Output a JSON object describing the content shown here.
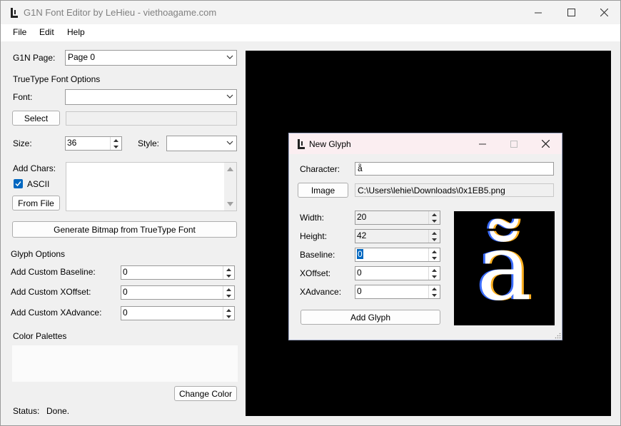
{
  "window": {
    "title": "G1N Font Editor by LeHieu - viethoagame.com"
  },
  "menu": {
    "file": "File",
    "edit": "Edit",
    "help": "Help"
  },
  "left": {
    "g1n_page_label": "G1N Page:",
    "g1n_page_value": "Page 0",
    "ttf_section": "TrueType Font Options",
    "font_label": "Font:",
    "font_value": "",
    "select_button": "Select",
    "size_label": "Size:",
    "size_value": "36",
    "style_label": "Style:",
    "style_value": "",
    "add_chars_label": "Add Chars:",
    "ascii_label": "ASCII",
    "ascii_checked": true,
    "from_file_button": "From File",
    "generate_button": "Generate Bitmap from TrueType Font",
    "glyph_section": "Glyph Options",
    "custom_baseline_label": "Add Custom Baseline:",
    "custom_baseline_value": "0",
    "custom_xoffset_label": "Add Custom XOffset:",
    "custom_xoffset_value": "0",
    "custom_xadvance_label": "Add Custom XAdvance:",
    "custom_xadvance_value": "0",
    "color_palettes_label": "Color Palettes",
    "change_color_button": "Change Color",
    "status_label": "Status:",
    "status_value": "Done."
  },
  "dialog": {
    "title": "New Glyph",
    "character_label": "Character:",
    "character_value": "ẵ",
    "image_button": "Image",
    "image_path": "C:\\Users\\lehie\\Downloads\\0x1EB5.png",
    "width_label": "Width:",
    "width_value": "20",
    "height_label": "Height:",
    "height_value": "42",
    "baseline_label": "Baseline:",
    "baseline_value": "0",
    "xoffset_label": "XOffset:",
    "xoffset_value": "0",
    "xadvance_label": "XAdvance:",
    "xadvance_value": "0",
    "add_glyph_button": "Add Glyph",
    "preview_glyph": "ẵ"
  },
  "colors": {
    "accent": "#0067c0",
    "canvas": "#000000"
  }
}
